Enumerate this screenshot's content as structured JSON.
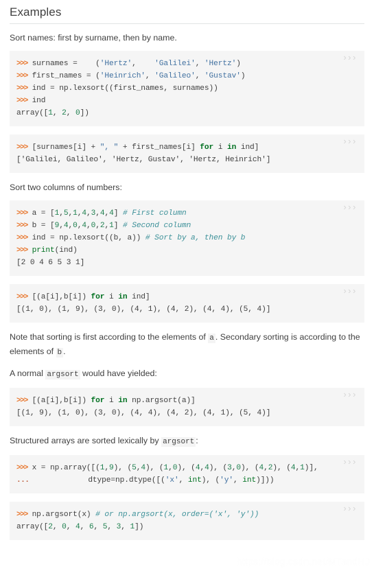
{
  "section": {
    "title": "Examples"
  },
  "copy_toggle_label": "›››",
  "watermark": "https://blog.csdn.net/MTandHJ",
  "paragraphs": {
    "p1": "Sort names: first by surname, then by name.",
    "p2": "Sort two columns of numbers:",
    "p3_a": "Note that sorting is first according to the elements of ",
    "p3_code1": "a",
    "p3_b": ". Secondary sorting is according to the elements of ",
    "p3_code2": "b",
    "p3_c": ".",
    "p4_a": "A normal ",
    "p4_code": "argsort",
    "p4_b": " would have yielded:",
    "p5_a": "Structured arrays are sorted lexically by ",
    "p5_code": "argsort",
    "p5_b": ":"
  },
  "code_blocks": [
    {
      "id": "block-lexsort-names",
      "lines": [
        [
          {
            "t": ">>>",
            "c": "prompt"
          },
          {
            "t": " surnames =    (",
            "c": "plain"
          },
          {
            "t": "'Hertz'",
            "c": "str"
          },
          {
            "t": ",    ",
            "c": "plain"
          },
          {
            "t": "'Galilei'",
            "c": "str"
          },
          {
            "t": ", ",
            "c": "plain"
          },
          {
            "t": "'Hertz'",
            "c": "str"
          },
          {
            "t": ")",
            "c": "plain"
          }
        ],
        [
          {
            "t": ">>>",
            "c": "prompt"
          },
          {
            "t": " first_names = (",
            "c": "plain"
          },
          {
            "t": "'Heinrich'",
            "c": "str"
          },
          {
            "t": ", ",
            "c": "plain"
          },
          {
            "t": "'Galileo'",
            "c": "str"
          },
          {
            "t": ", ",
            "c": "plain"
          },
          {
            "t": "'Gustav'",
            "c": "str"
          },
          {
            "t": ")",
            "c": "plain"
          }
        ],
        [
          {
            "t": ">>>",
            "c": "prompt"
          },
          {
            "t": " ind = np.lexsort((first_names, surnames))",
            "c": "plain"
          }
        ],
        [
          {
            "t": ">>>",
            "c": "prompt"
          },
          {
            "t": " ind",
            "c": "plain"
          }
        ],
        [
          {
            "t": "array([",
            "c": "plain"
          },
          {
            "t": "1",
            "c": "num"
          },
          {
            "t": ", ",
            "c": "plain"
          },
          {
            "t": "2",
            "c": "num"
          },
          {
            "t": ", ",
            "c": "plain"
          },
          {
            "t": "0",
            "c": "num"
          },
          {
            "t": "])",
            "c": "plain"
          }
        ]
      ]
    },
    {
      "id": "block-join-names",
      "lines": [
        [
          {
            "t": ">>>",
            "c": "prompt"
          },
          {
            "t": " [surnames[i] + ",
            "c": "plain"
          },
          {
            "t": "\", \"",
            "c": "str"
          },
          {
            "t": " + first_names[i] ",
            "c": "plain"
          },
          {
            "t": "for",
            "c": "kw"
          },
          {
            "t": " i ",
            "c": "plain"
          },
          {
            "t": "in",
            "c": "kw"
          },
          {
            "t": " ind]",
            "c": "plain"
          }
        ],
        [
          {
            "t": "['Galilei, Galileo', 'Hertz, Gustav', 'Hertz, Heinrich']",
            "c": "plain"
          }
        ]
      ]
    },
    {
      "id": "block-lexsort-numbers",
      "lines": [
        [
          {
            "t": ">>>",
            "c": "prompt"
          },
          {
            "t": " a = [",
            "c": "plain"
          },
          {
            "t": "1",
            "c": "num"
          },
          {
            "t": ",",
            "c": "plain"
          },
          {
            "t": "5",
            "c": "num"
          },
          {
            "t": ",",
            "c": "plain"
          },
          {
            "t": "1",
            "c": "num"
          },
          {
            "t": ",",
            "c": "plain"
          },
          {
            "t": "4",
            "c": "num"
          },
          {
            "t": ",",
            "c": "plain"
          },
          {
            "t": "3",
            "c": "num"
          },
          {
            "t": ",",
            "c": "plain"
          },
          {
            "t": "4",
            "c": "num"
          },
          {
            "t": ",",
            "c": "plain"
          },
          {
            "t": "4",
            "c": "num"
          },
          {
            "t": "] ",
            "c": "plain"
          },
          {
            "t": "# First column",
            "c": "com"
          }
        ],
        [
          {
            "t": ">>>",
            "c": "prompt"
          },
          {
            "t": " b = [",
            "c": "plain"
          },
          {
            "t": "9",
            "c": "num"
          },
          {
            "t": ",",
            "c": "plain"
          },
          {
            "t": "4",
            "c": "num"
          },
          {
            "t": ",",
            "c": "plain"
          },
          {
            "t": "0",
            "c": "num"
          },
          {
            "t": ",",
            "c": "plain"
          },
          {
            "t": "4",
            "c": "num"
          },
          {
            "t": ",",
            "c": "plain"
          },
          {
            "t": "0",
            "c": "num"
          },
          {
            "t": ",",
            "c": "plain"
          },
          {
            "t": "2",
            "c": "num"
          },
          {
            "t": ",",
            "c": "plain"
          },
          {
            "t": "1",
            "c": "num"
          },
          {
            "t": "] ",
            "c": "plain"
          },
          {
            "t": "# Second column",
            "c": "com"
          }
        ],
        [
          {
            "t": ">>>",
            "c": "prompt"
          },
          {
            "t": " ind = np.lexsort((b, a)) ",
            "c": "plain"
          },
          {
            "t": "# Sort by a, then by b",
            "c": "com"
          }
        ],
        [
          {
            "t": ">>>",
            "c": "prompt"
          },
          {
            "t": " ",
            "c": "plain"
          },
          {
            "t": "print",
            "c": "builtin"
          },
          {
            "t": "(ind)",
            "c": "plain"
          }
        ],
        [
          {
            "t": "[2 0 4 6 5 3 1]",
            "c": "plain"
          }
        ]
      ]
    },
    {
      "id": "block-pairs-lexsort",
      "lines": [
        [
          {
            "t": ">>>",
            "c": "prompt"
          },
          {
            "t": " [(a[i],b[i]) ",
            "c": "plain"
          },
          {
            "t": "for",
            "c": "kw"
          },
          {
            "t": " i ",
            "c": "plain"
          },
          {
            "t": "in",
            "c": "kw"
          },
          {
            "t": " ind]",
            "c": "plain"
          }
        ],
        [
          {
            "t": "[(1, 0), (1, 9), (3, 0), (4, 1), (4, 2), (4, 4), (5, 4)]",
            "c": "plain"
          }
        ]
      ]
    },
    {
      "id": "block-pairs-argsort",
      "lines": [
        [
          {
            "t": ">>>",
            "c": "prompt"
          },
          {
            "t": " [(a[i],b[i]) ",
            "c": "plain"
          },
          {
            "t": "for",
            "c": "kw"
          },
          {
            "t": " i ",
            "c": "plain"
          },
          {
            "t": "in",
            "c": "kw"
          },
          {
            "t": " np.argsort(a)]",
            "c": "plain"
          }
        ],
        [
          {
            "t": "[(1, 9), (1, 0), (3, 0), (4, 4), (4, 2), (4, 1), (5, 4)]",
            "c": "plain"
          }
        ]
      ]
    },
    {
      "id": "block-structured-array",
      "lines": [
        [
          {
            "t": ">>>",
            "c": "prompt"
          },
          {
            "t": " x = np.array([(",
            "c": "plain"
          },
          {
            "t": "1",
            "c": "num"
          },
          {
            "t": ",",
            "c": "plain"
          },
          {
            "t": "9",
            "c": "num"
          },
          {
            "t": "), (",
            "c": "plain"
          },
          {
            "t": "5",
            "c": "num"
          },
          {
            "t": ",",
            "c": "plain"
          },
          {
            "t": "4",
            "c": "num"
          },
          {
            "t": "), (",
            "c": "plain"
          },
          {
            "t": "1",
            "c": "num"
          },
          {
            "t": ",",
            "c": "plain"
          },
          {
            "t": "0",
            "c": "num"
          },
          {
            "t": "), (",
            "c": "plain"
          },
          {
            "t": "4",
            "c": "num"
          },
          {
            "t": ",",
            "c": "plain"
          },
          {
            "t": "4",
            "c": "num"
          },
          {
            "t": "), (",
            "c": "plain"
          },
          {
            "t": "3",
            "c": "num"
          },
          {
            "t": ",",
            "c": "plain"
          },
          {
            "t": "0",
            "c": "num"
          },
          {
            "t": "), (",
            "c": "plain"
          },
          {
            "t": "4",
            "c": "num"
          },
          {
            "t": ",",
            "c": "plain"
          },
          {
            "t": "2",
            "c": "num"
          },
          {
            "t": "), (",
            "c": "plain"
          },
          {
            "t": "4",
            "c": "num"
          },
          {
            "t": ",",
            "c": "plain"
          },
          {
            "t": "1",
            "c": "num"
          },
          {
            "t": ")],",
            "c": "plain"
          }
        ],
        [
          {
            "t": "...",
            "c": "cont"
          },
          {
            "t": "             dtype=np.dtype([(",
            "c": "plain"
          },
          {
            "t": "'x'",
            "c": "str"
          },
          {
            "t": ", ",
            "c": "plain"
          },
          {
            "t": "int",
            "c": "builtin"
          },
          {
            "t": "), (",
            "c": "plain"
          },
          {
            "t": "'y'",
            "c": "str"
          },
          {
            "t": ", ",
            "c": "plain"
          },
          {
            "t": "int",
            "c": "builtin"
          },
          {
            "t": ")]))",
            "c": "plain"
          }
        ]
      ]
    },
    {
      "id": "block-argsort-structured",
      "lines": [
        [
          {
            "t": ">>>",
            "c": "prompt"
          },
          {
            "t": " np.argsort(x) ",
            "c": "plain"
          },
          {
            "t": "# or np.argsort(x, order=('x', 'y'))",
            "c": "com"
          }
        ],
        [
          {
            "t": "array([",
            "c": "plain"
          },
          {
            "t": "2",
            "c": "num"
          },
          {
            "t": ", ",
            "c": "plain"
          },
          {
            "t": "0",
            "c": "num"
          },
          {
            "t": ", ",
            "c": "plain"
          },
          {
            "t": "4",
            "c": "num"
          },
          {
            "t": ", ",
            "c": "plain"
          },
          {
            "t": "6",
            "c": "num"
          },
          {
            "t": ", ",
            "c": "plain"
          },
          {
            "t": "5",
            "c": "num"
          },
          {
            "t": ", ",
            "c": "plain"
          },
          {
            "t": "3",
            "c": "num"
          },
          {
            "t": ", ",
            "c": "plain"
          },
          {
            "t": "1",
            "c": "num"
          },
          {
            "t": "])",
            "c": "plain"
          }
        ]
      ]
    }
  ],
  "colors": {
    "text": "#404040",
    "code_bg": "#f5f5f5",
    "prompt": "#e8762c",
    "string": "#4070a0",
    "number": "#208050",
    "keyword": "#007020",
    "comment": "#3d9199",
    "rule": "#e1e4e5",
    "copy_toggle": "#d7d7d7"
  }
}
